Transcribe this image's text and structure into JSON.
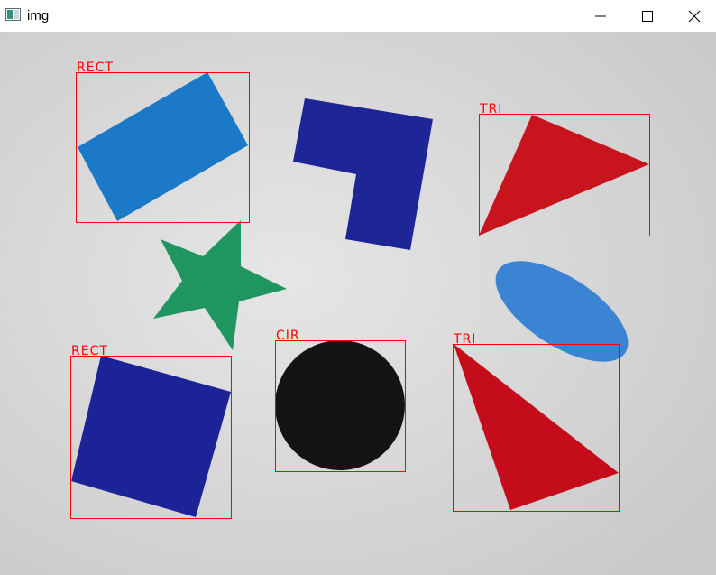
{
  "window": {
    "title": "img",
    "app_icon": "image-window-icon",
    "controls": {
      "minimize_icon": "minimize-icon",
      "maximize_icon": "maximize-icon",
      "close_icon": "close-icon"
    }
  },
  "canvas": {
    "background": "#d8d8d8",
    "detections": [
      {
        "label": "RECT",
        "color": "#ff0000"
      },
      {
        "label": "TRI",
        "color": "#ff0000"
      },
      {
        "label": "RECT",
        "color": "#ff0000"
      },
      {
        "label": "CIR",
        "color": "#ff0000"
      },
      {
        "label": "TRI",
        "color": "#ff0000"
      }
    ],
    "shape_colors": {
      "light_blue_rect": "#1b79c8",
      "navy_l_shape": "#1e2596",
      "red_triangle": "#c8141d",
      "green_star": "#1f9660",
      "blue_ellipse": "#3b83d3",
      "navy_square": "#1c2396",
      "black_circle": "#141414",
      "red_triangle_2": "#c40c1a"
    }
  }
}
